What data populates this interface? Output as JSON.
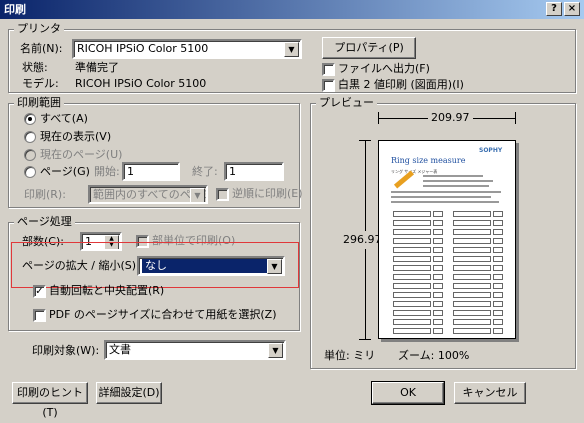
{
  "window": {
    "title": "印刷",
    "help_label": "?",
    "close_label": "×"
  },
  "printer": {
    "legend": "プリンタ",
    "name_label": "名前(N):",
    "name_value": "RICOH IPSiO Color 5100",
    "properties_button": "プロパティ(P)",
    "status_label": "状態:",
    "status_value": "準備完了",
    "model_label": "モデル:",
    "model_value": "RICOH IPSiO Color 5100",
    "print_to_file": "ファイルへ出力(F)",
    "mono_print": "白黒 2 値印刷 (図面用)(I)"
  },
  "range": {
    "legend": "印刷範囲",
    "all": "すべて(A)",
    "current_view": "現在の表示(V)",
    "current_page": "現在のページ(U)",
    "pages": "ページ(G)",
    "start_label": "開始:",
    "start_value": "1",
    "end_label": "終了:",
    "end_value": "1",
    "subset_label": "印刷(R):",
    "subset_value": "範囲内のすべてのページ",
    "reverse": "逆順に印刷(E)"
  },
  "handling": {
    "legend": "ページ処理",
    "copies_label": "部数(C):",
    "copies_value": "1",
    "collate": "部単位で印刷(O)",
    "scaling_label": "ページの拡大 / 縮小(S):",
    "scaling_value": "なし",
    "auto_rotate": "自動回転と中央配置(R)",
    "pdf_page_size": "PDF のページサイズに合わせて用紙を選択(Z)"
  },
  "print_what": {
    "label": "印刷対象(W):",
    "value": "文書"
  },
  "preview": {
    "legend": "プレビュー",
    "width_value": "209.97",
    "height_value": "296.97",
    "units": "単位: ミリ",
    "zoom": "ズーム: 100%",
    "doc_title": "Ring size measure",
    "doc_subtitle": "リング サイズ メジャー表",
    "doc_logo": "SOPHY"
  },
  "footer": {
    "hints_button": "印刷のヒント(T)",
    "advanced_button": "詳細設定(D)",
    "ok_button": "OK",
    "cancel_button": "キャンセル"
  },
  "colors": {
    "highlight_border": "#e0383a",
    "selection": "#0a246a"
  }
}
